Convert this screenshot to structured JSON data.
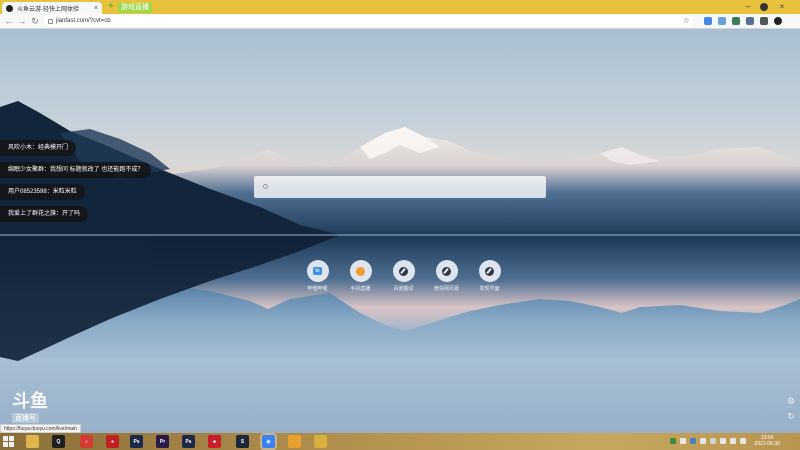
{
  "browser": {
    "tab": {
      "title": "斗鱼云游-轻快上网体验",
      "close": "×"
    },
    "new_tab": "+",
    "tag_label": "游戏直播",
    "window": {
      "minimize": "–",
      "close": "×"
    },
    "nav": {
      "back": "←",
      "forward": "→",
      "reload": "↻"
    },
    "url": "jianfast.com/?cvt=cb",
    "star": "☆"
  },
  "danmu": [
    "风吹小木：经典模开门",
    "绵眠少女聚群：我想问 标题就改了 也还能跑不成？",
    "用户08523598：米粒米粒",
    "我爱上了群花之旗：开了吗"
  ],
  "shortcuts": [
    {
      "label": "哔哩哔哩",
      "glyph": "bilibili-icon",
      "mark": "bi"
    },
    {
      "label": "手机直播",
      "glyph": "orange-app-icon"
    },
    {
      "label": "百度翻译",
      "glyph": "compass-icon"
    },
    {
      "label": "微信网页版",
      "glyph": "compass-icon"
    },
    {
      "label": "发现号面",
      "glyph": "compass-icon"
    }
  ],
  "watermark": {
    "title": "斗鱼",
    "subtitle": "直播号"
  },
  "status_url": "https://huya.douyu.com/live/main",
  "side_buttons": {
    "settings": "⚙",
    "refresh": "↻"
  },
  "taskbar": {
    "apps": [
      {
        "name": "file-explorer",
        "color": "#e0b44a",
        "mark": ""
      },
      {
        "name": "qq",
        "color": "#1e1e1e",
        "mark": "Q"
      },
      {
        "name": "netease-music",
        "color": "#d43c33",
        "mark": "♪"
      },
      {
        "name": "player",
        "color": "#c02020",
        "mark": "●"
      },
      {
        "name": "photoshop",
        "color": "#1c2a48",
        "mark": "Ps"
      },
      {
        "name": "premiere",
        "color": "#2a1a48",
        "mark": "Pr"
      },
      {
        "name": "photoshop-2",
        "color": "#1c2a48",
        "mark": "Ps"
      },
      {
        "name": "maple",
        "color": "#c8202a",
        "mark": "♣"
      },
      {
        "name": "steam",
        "color": "#1b2838",
        "mark": "S"
      },
      {
        "name": "chrome",
        "color": "#3a82f0",
        "mark": "◉"
      },
      {
        "name": "app-orange",
        "color": "#e8a030",
        "mark": ""
      },
      {
        "name": "app-game",
        "color": "#d8b040",
        "mark": ""
      }
    ],
    "time": "19:04",
    "date": "2021-06-30"
  },
  "colors": {
    "title_bar": "#e8c23c",
    "accent_green": "#9ed84d"
  }
}
